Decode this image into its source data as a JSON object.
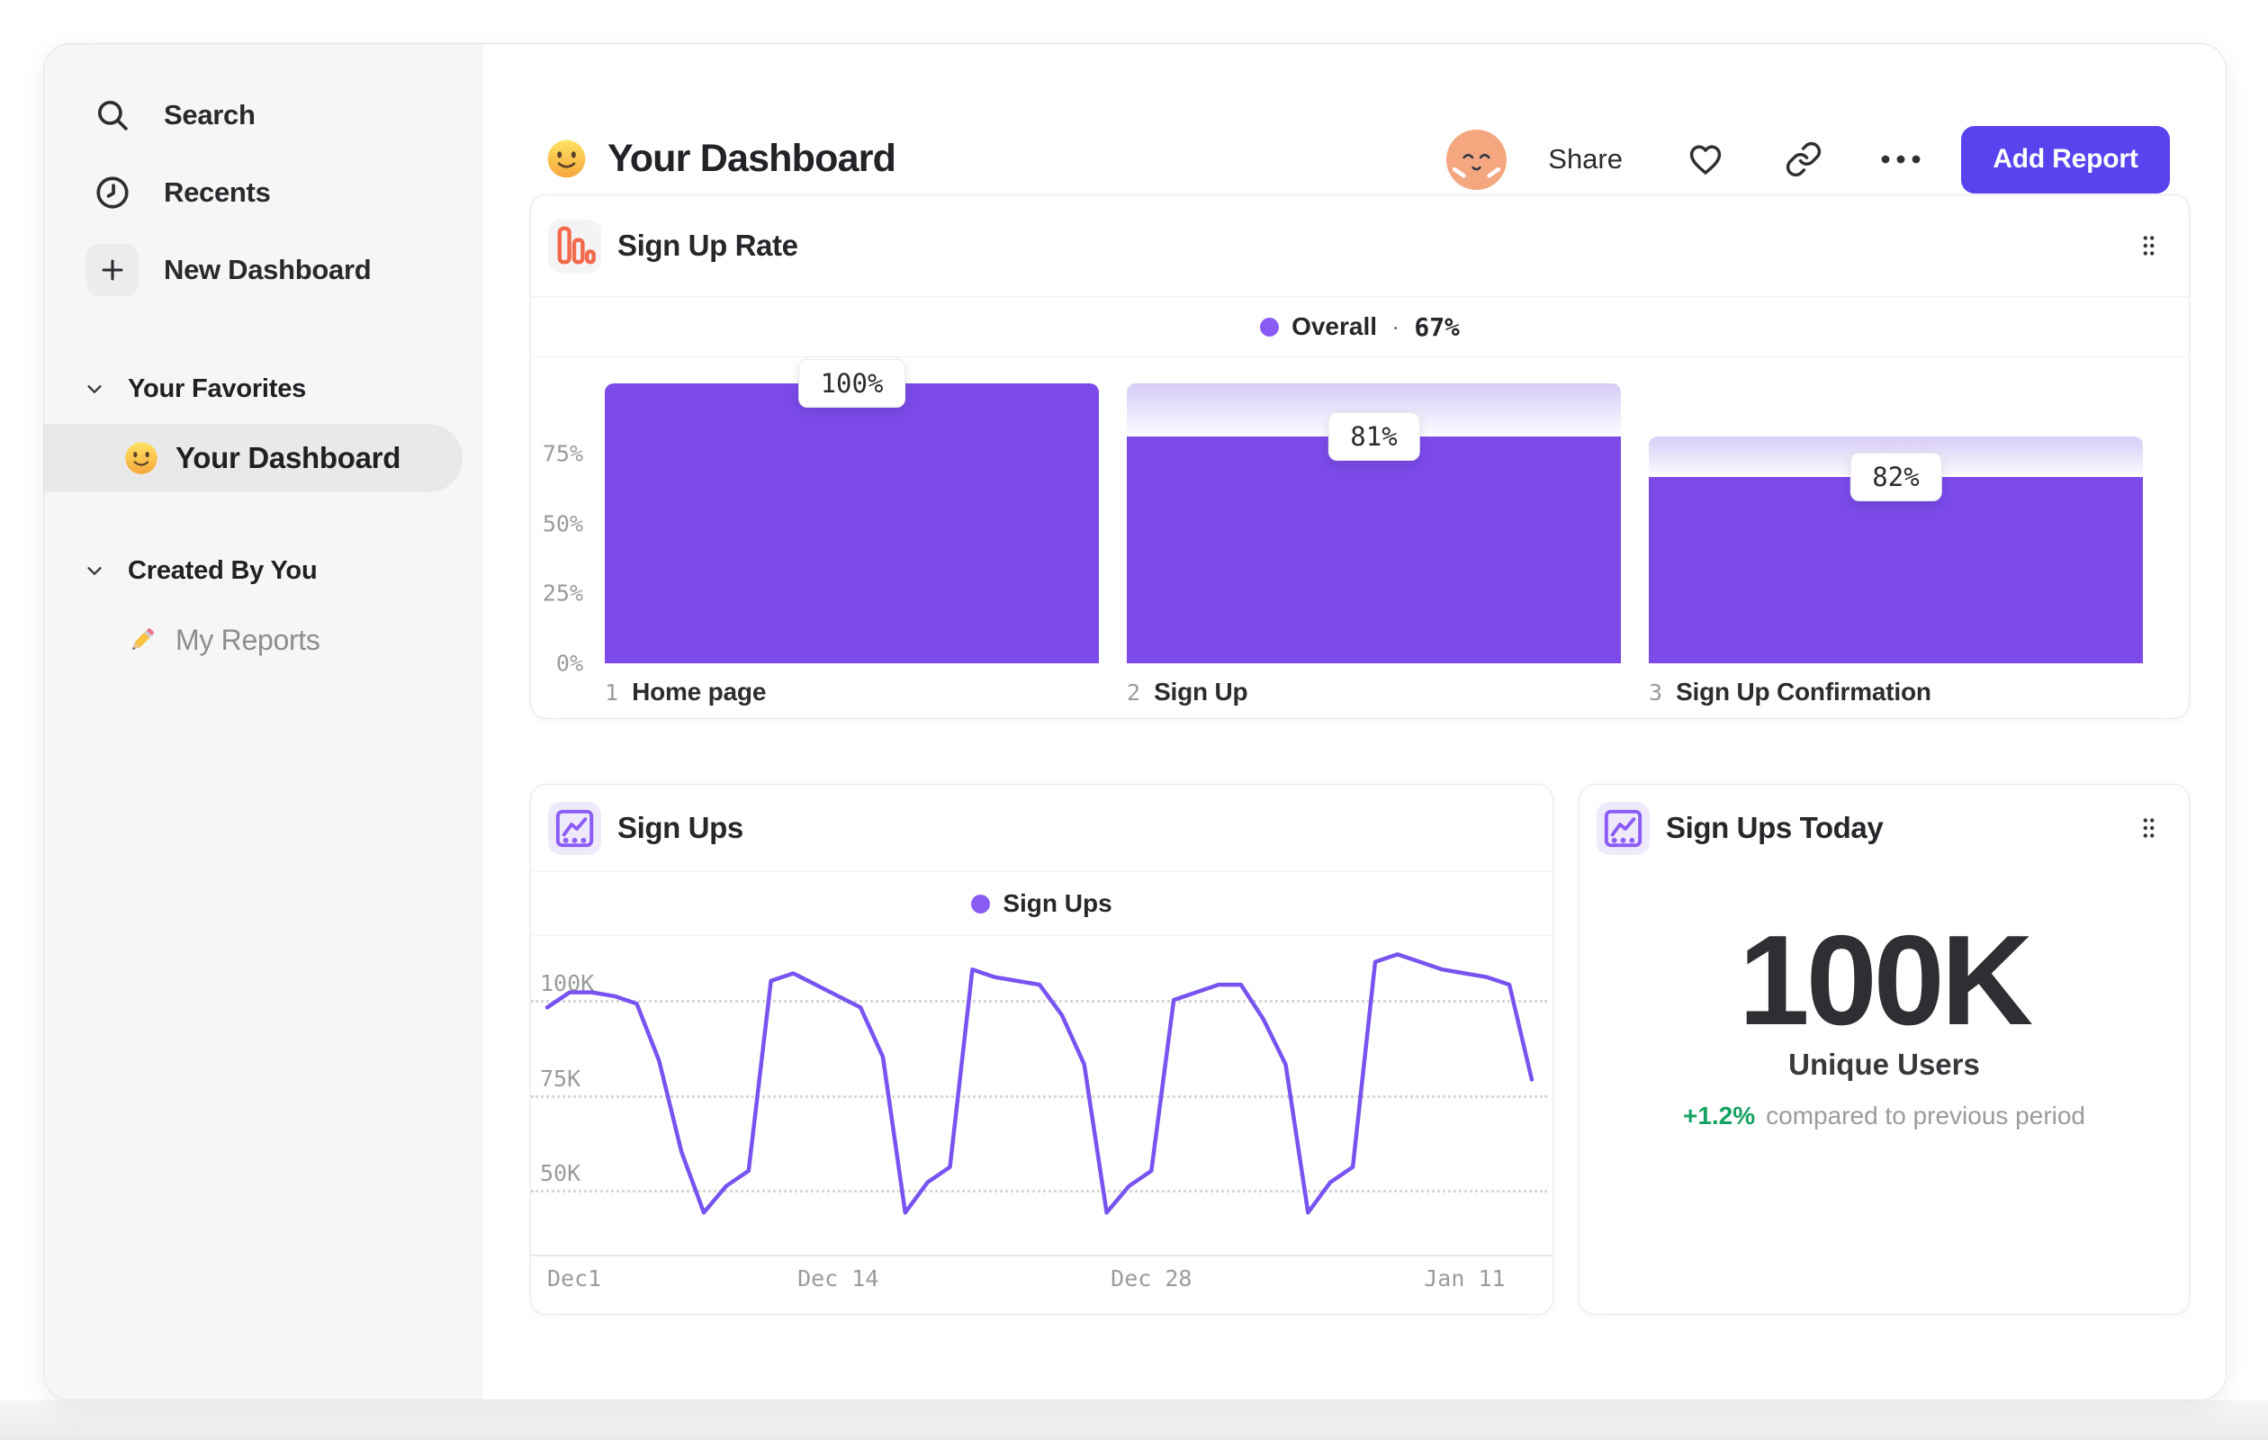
{
  "sidebar": {
    "nav": [
      {
        "icon": "search-icon",
        "label": "Search"
      },
      {
        "icon": "clock-icon",
        "label": "Recents"
      },
      {
        "icon": "plus-icon",
        "label": "New Dashboard"
      }
    ],
    "sections": [
      {
        "icon": "chevron-down-icon",
        "label": "Your Favorites",
        "items": [
          {
            "icon": "smiley-emoji",
            "label": "Your Dashboard",
            "selected": true
          }
        ]
      },
      {
        "icon": "chevron-down-icon",
        "label": "Created By You",
        "items": [
          {
            "icon": "pencil-emoji",
            "label": "My Reports",
            "selected": false
          }
        ]
      }
    ]
  },
  "header": {
    "emoji": "smiley-emoji",
    "title": "Your Dashboard",
    "avatar": "face-avatar",
    "share_label": "Share",
    "icons": [
      "heart-icon",
      "link-icon",
      "ellipsis-icon"
    ],
    "add_report_label": "Add Report"
  },
  "cards": {
    "funnel": {
      "icon": "funnel-bars-icon",
      "title": "Sign Up Rate",
      "legend_name": "Overall",
      "legend_sep": "·",
      "legend_value": "67%"
    },
    "line": {
      "icon": "line-chart-icon",
      "title": "Sign Ups",
      "legend_name": "Sign Ups"
    },
    "stat": {
      "icon": "line-chart-icon",
      "title": "Sign Ups Today",
      "value": "100K",
      "label": "Unique Users",
      "delta": "+1.2%",
      "delta_note": "compared to previous period"
    }
  },
  "colors": {
    "accent_purple": "#7b4ae9",
    "line_purple": "#7753f0",
    "legend_dot": "#8a5cf5",
    "button_purple": "#5843ef",
    "icon_orange": "#f26a4c",
    "avatar_orange": "#f4a77f",
    "delta_green": "#15a262",
    "gray_text": "#9b9b9b"
  },
  "chart_data": [
    {
      "type": "bar",
      "subtype": "funnel",
      "title": "Sign Up Rate",
      "legend": "Overall · 67%",
      "overall_conversion_pct": 67,
      "ylim": [
        0,
        100
      ],
      "yticks": [
        {
          "label": "75%",
          "value": 75
        },
        {
          "label": "50%",
          "value": 50
        },
        {
          "label": "25%",
          "value": 25
        },
        {
          "label": "0%",
          "value": 0
        }
      ],
      "categories": [
        "1 Home page",
        "2 Sign Up",
        "3 Sign Up Confirmation"
      ],
      "steps": [
        {
          "index": "1",
          "label": "Home page",
          "conversion_label": "100%",
          "top_pct": 100,
          "solid_pct": 100
        },
        {
          "index": "2",
          "label": "Sign Up",
          "conversion_label": "81%",
          "top_pct": 100,
          "solid_pct": 81
        },
        {
          "index": "3",
          "label": "Sign Up Confirmation",
          "conversion_label": "82%",
          "top_pct": 81,
          "solid_pct": 66.4
        }
      ]
    },
    {
      "type": "line",
      "title": "Sign Ups",
      "legend": "Sign Ups",
      "grid": "dotted-horizontal",
      "legend_position": "top-center",
      "ylim_k": [
        33,
        115
      ],
      "yticks": [
        {
          "label": "100K",
          "value": 100
        },
        {
          "label": "75K",
          "value": 75
        },
        {
          "label": "50K",
          "value": 50
        }
      ],
      "x_ticks": [
        {
          "label": "Dec1",
          "day": 0
        },
        {
          "label": "Dec 14",
          "day": 13
        },
        {
          "label": "Dec 28",
          "day": 27
        },
        {
          "label": "Jan 11",
          "day": 41
        }
      ],
      "values_unit": "K",
      "values": [
        98,
        102,
        102,
        101,
        99,
        84,
        60,
        44,
        51,
        55,
        105,
        107,
        104,
        101,
        98,
        85,
        44,
        52,
        56,
        108,
        106,
        105,
        104,
        96,
        83,
        44,
        51,
        55,
        100,
        102,
        104,
        104,
        95,
        83,
        44,
        52,
        56,
        110,
        112,
        110,
        108,
        107,
        106,
        104,
        79
      ]
    }
  ]
}
